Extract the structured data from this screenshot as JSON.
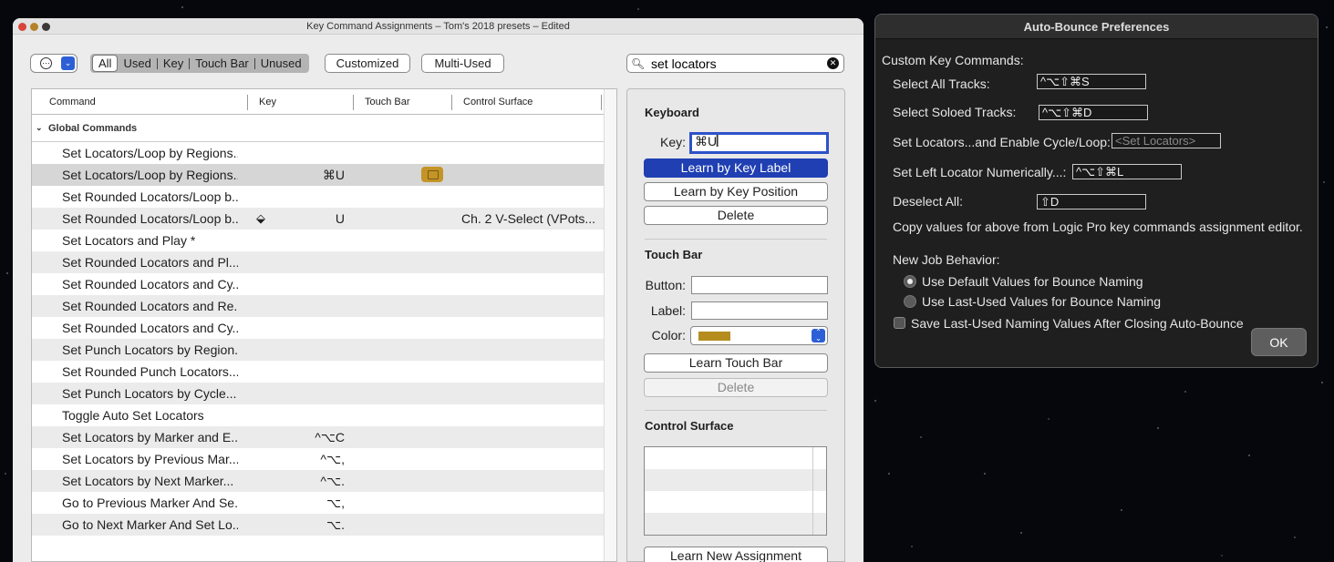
{
  "main_window": {
    "title": "Key Command Assignments – Tom's 2018 presets – Edited",
    "toolbar": {
      "filters": [
        "All",
        "Used",
        "Key",
        "Touch Bar",
        "Unused"
      ],
      "customized_label": "Customized",
      "multi_used_label": "Multi-Used",
      "search_value": "set locators"
    },
    "table": {
      "columns": [
        "Command",
        "Key",
        "Touch Bar",
        "Control Surface"
      ],
      "group": "Global Commands",
      "rows": [
        {
          "command": "Set Locators/Loop by Regions...",
          "key": "",
          "control_surface": ""
        },
        {
          "command": "Set Locators/Loop by Regions...",
          "key": "⌘U",
          "control_surface": ""
        },
        {
          "command": "Set Rounded Locators/Loop b...",
          "key": "",
          "control_surface": ""
        },
        {
          "command": "Set Rounded Locators/Loop b...",
          "key": "U",
          "control_surface": "Ch. 2 V-Select (VPots..."
        },
        {
          "command": "Set Locators and Play *",
          "key": "",
          "control_surface": ""
        },
        {
          "command": "Set Rounded Locators and Pl...",
          "key": "",
          "control_surface": ""
        },
        {
          "command": "Set Rounded Locators and Cy...",
          "key": "",
          "control_surface": ""
        },
        {
          "command": "Set Rounded Locators and Re...",
          "key": "",
          "control_surface": ""
        },
        {
          "command": "Set Rounded Locators and Cy...",
          "key": "",
          "control_surface": ""
        },
        {
          "command": "Set Punch Locators by Region...",
          "key": "",
          "control_surface": ""
        },
        {
          "command": "Set Rounded Punch Locators...",
          "key": "",
          "control_surface": ""
        },
        {
          "command": "Set Punch Locators by Cycle...",
          "key": "",
          "control_surface": ""
        },
        {
          "command": "Toggle Auto Set Locators",
          "key": "",
          "control_surface": ""
        },
        {
          "command": "Set Locators by Marker and E...",
          "key": "^⌥C",
          "control_surface": ""
        },
        {
          "command": "Set Locators by Previous Mar...",
          "key": "^⌥,",
          "control_surface": ""
        },
        {
          "command": "Set Locators by Next Marker...",
          "key": "^⌥.",
          "control_surface": ""
        },
        {
          "command": "Go to Previous Marker And Se...",
          "key": "⌥,",
          "control_surface": ""
        },
        {
          "command": "Go to Next Marker And Set Lo...",
          "key": "⌥.",
          "control_surface": ""
        }
      ]
    },
    "inspector": {
      "keyboard_heading": "Keyboard",
      "key_label": "Key:",
      "key_value": "⌘U",
      "learn_by_key_label": "Learn by Key Label",
      "learn_by_key_position": "Learn by Key Position",
      "delete_label": "Delete",
      "touch_bar_heading": "Touch Bar",
      "button_label": "Button:",
      "label_label": "Label:",
      "color_label": "Color:",
      "learn_touch_bar": "Learn Touch Bar",
      "delete_tb_label": "Delete",
      "control_surface_heading": "Control Surface",
      "learn_new_assignment": "Learn New Assignment",
      "accent_color": "#1f3fb2",
      "touch_bar_color": "#b48d1e"
    }
  },
  "auto_bounce": {
    "title": "Auto-Bounce Preferences",
    "custom_key_commands": "Custom Key Commands:",
    "items": [
      {
        "label": "Select All Tracks:",
        "value": "^⌥⇧⌘S"
      },
      {
        "label": "Select Soloed Tracks:",
        "value": "^⌥⇧⌘D"
      },
      {
        "label": "Set Locators...and Enable Cycle/Loop:",
        "value": "<Set Locators>"
      },
      {
        "label": "Set Left Locator Numerically...:",
        "value": "^⌥⇧⌘L"
      },
      {
        "label": "Deselect All:",
        "value": "⇧D"
      }
    ],
    "copy_note": "Copy values for above from Logic Pro key commands assignment editor.",
    "new_job_behavior": "New Job Behavior:",
    "radio_default": "Use Default Values for Bounce Naming",
    "radio_last_used": "Use Last-Used Values for Bounce Naming",
    "checkbox_save": "Save Last-Used Naming Values After Closing Auto-Bounce",
    "ok_label": "OK"
  }
}
